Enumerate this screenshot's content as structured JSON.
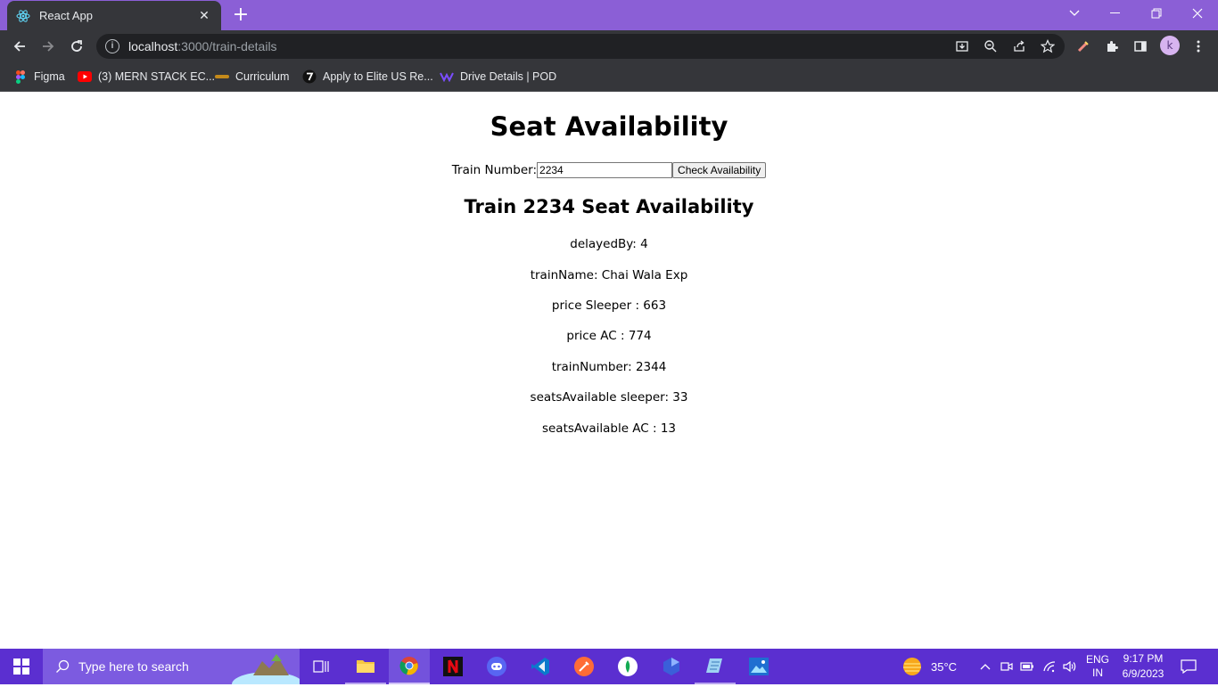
{
  "browser": {
    "tab_title": "React App",
    "url_host": "localhost",
    "url_path": ":3000/train-details",
    "bookmarks": [
      {
        "label": "Figma",
        "icon": "figma-icon"
      },
      {
        "label": "(3) MERN STACK EC...",
        "icon": "youtube-icon"
      },
      {
        "label": "Curriculum",
        "icon": "curriculum-icon"
      },
      {
        "label": "Apply to Elite US Re...",
        "icon": "turing-icon"
      },
      {
        "label": "Drive Details | POD",
        "icon": "pod-icon"
      }
    ],
    "profile_initial": "k"
  },
  "page": {
    "title": "Seat Availability",
    "train_label": "Train Number:",
    "train_input_value": "2234",
    "check_button": "Check Availability",
    "result_title": "Train 2234 Seat Availability",
    "details": [
      "delayedBy: 4",
      "trainName: Chai Wala Exp",
      "price Sleeper : 663",
      "price AC : 774",
      "trainNumber: 2344",
      "seatsAvailable sleeper: 33",
      "seatsAvailable AC : 13"
    ]
  },
  "taskbar": {
    "search_placeholder": "Type here to search",
    "temperature": "35°C",
    "lang_top": "ENG",
    "lang_bottom": "IN",
    "time": "9:17 PM",
    "date": "6/9/2023"
  },
  "colors": {
    "tab_strip": "#8b5fd6",
    "toolbar": "#35363a",
    "taskbar": "#5b2fd0"
  }
}
